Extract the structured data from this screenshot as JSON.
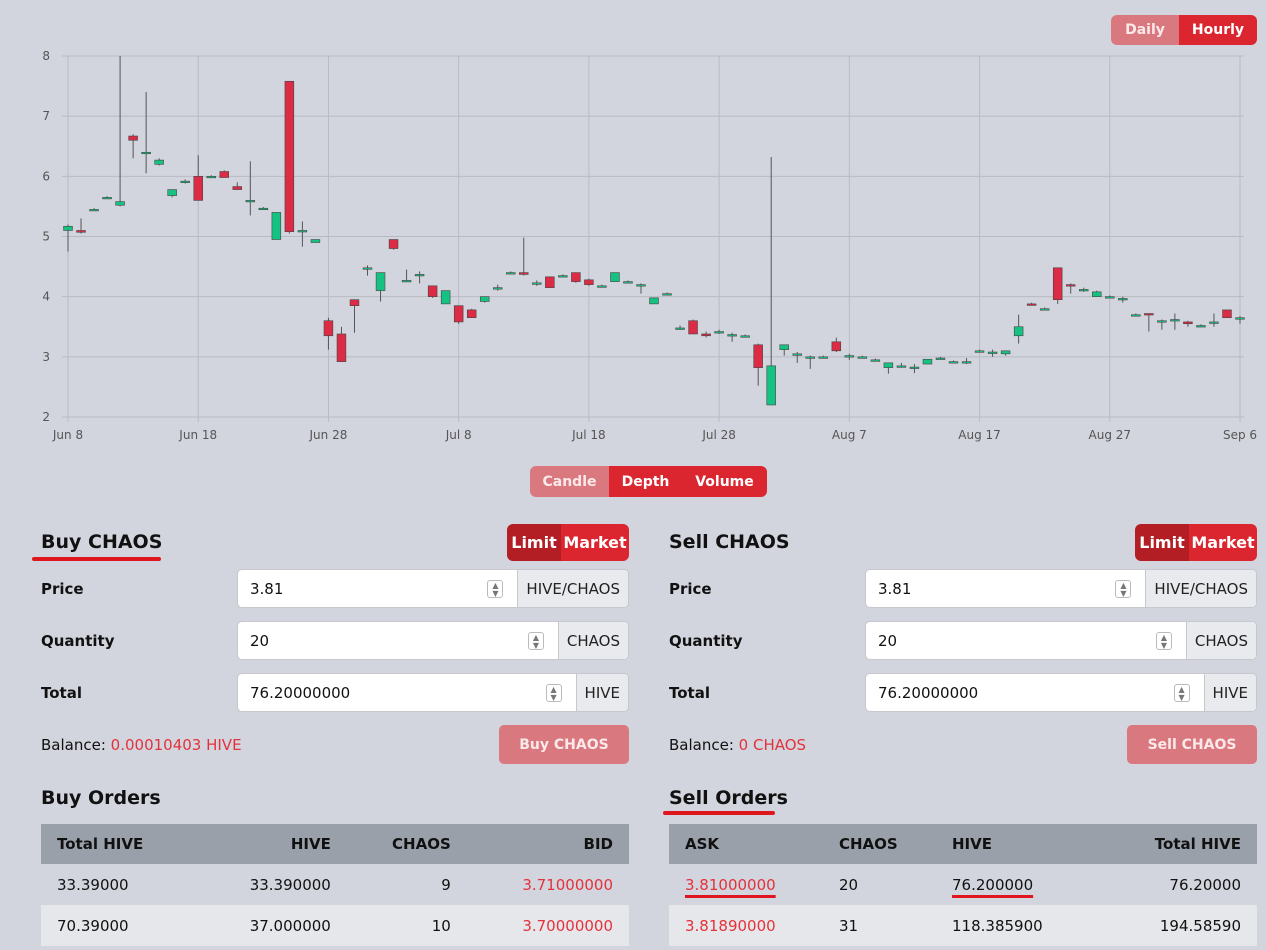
{
  "timeframe": {
    "daily": "Daily",
    "hourly": "Hourly"
  },
  "chart_view": {
    "candle": "Candle",
    "depth": "Depth",
    "volume": "Volume"
  },
  "colors": {
    "up": "#16c281",
    "down": "#dc2b45",
    "accent": "#dc262f"
  },
  "chart_data": {
    "type": "candlestick",
    "y_ticks": [
      "2",
      "3",
      "4",
      "5",
      "6",
      "7",
      "8"
    ],
    "ylim": [
      2,
      8
    ],
    "x_ticks": [
      "Jun 8",
      "Jun 18",
      "Jun 28",
      "Jul 8",
      "Jul 18",
      "Jul 28",
      "Aug 7",
      "Aug 17",
      "Aug 27",
      "Sep 6"
    ],
    "grid": true,
    "candles": [
      {
        "o": 5.1,
        "h": 5.2,
        "l": 4.75,
        "c": 5.17
      },
      {
        "o": 5.1,
        "h": 5.3,
        "l": 5.05,
        "c": 5.07
      },
      {
        "o": 5.45,
        "h": 5.47,
        "l": 5.43,
        "c": 5.45
      },
      {
        "o": 5.65,
        "h": 5.67,
        "l": 5.63,
        "c": 5.65
      },
      {
        "o": 5.52,
        "h": 8.0,
        "l": 5.5,
        "c": 5.58
      },
      {
        "o": 6.67,
        "h": 6.7,
        "l": 6.3,
        "c": 6.6
      },
      {
        "o": 6.4,
        "h": 7.4,
        "l": 6.05,
        "c": 6.4
      },
      {
        "o": 6.2,
        "h": 6.3,
        "l": 6.18,
        "c": 6.27
      },
      {
        "o": 5.68,
        "h": 5.78,
        "l": 5.65,
        "c": 5.78
      },
      {
        "o": 5.92,
        "h": 5.95,
        "l": 5.88,
        "c": 5.92
      },
      {
        "o": 6.0,
        "h": 6.35,
        "l": 5.6,
        "c": 5.6
      },
      {
        "o": 6.0,
        "h": 6.02,
        "l": 5.98,
        "c": 6.0
      },
      {
        "o": 6.08,
        "h": 6.1,
        "l": 5.98,
        "c": 5.98
      },
      {
        "o": 5.83,
        "h": 5.9,
        "l": 5.78,
        "c": 5.78
      },
      {
        "o": 5.6,
        "h": 6.25,
        "l": 5.35,
        "c": 5.6
      },
      {
        "o": 5.47,
        "h": 5.49,
        "l": 5.45,
        "c": 5.47
      },
      {
        "o": 4.95,
        "h": 5.4,
        "l": 4.95,
        "c": 5.4
      },
      {
        "o": 7.58,
        "h": 7.58,
        "l": 5.05,
        "c": 5.08
      },
      {
        "o": 5.1,
        "h": 5.25,
        "l": 4.83,
        "c": 5.1
      },
      {
        "o": 4.9,
        "h": 4.95,
        "l": 4.9,
        "c": 4.95
      },
      {
        "o": 3.6,
        "h": 3.65,
        "l": 3.12,
        "c": 3.35
      },
      {
        "o": 3.38,
        "h": 3.5,
        "l": 2.92,
        "c": 2.92
      },
      {
        "o": 3.95,
        "h": 3.95,
        "l": 3.4,
        "c": 3.85
      },
      {
        "o": 4.48,
        "h": 4.52,
        "l": 4.35,
        "c": 4.48
      },
      {
        "o": 4.1,
        "h": 4.4,
        "l": 3.92,
        "c": 4.4
      },
      {
        "o": 4.95,
        "h": 4.95,
        "l": 4.78,
        "c": 4.8
      },
      {
        "o": 4.27,
        "h": 4.45,
        "l": 4.27,
        "c": 4.27
      },
      {
        "o": 4.37,
        "h": 4.42,
        "l": 4.22,
        "c": 4.37
      },
      {
        "o": 4.18,
        "h": 4.18,
        "l": 3.98,
        "c": 4.0
      },
      {
        "o": 3.88,
        "h": 4.1,
        "l": 3.88,
        "c": 4.1
      },
      {
        "o": 3.85,
        "h": 3.85,
        "l": 3.55,
        "c": 3.58
      },
      {
        "o": 3.78,
        "h": 3.8,
        "l": 3.65,
        "c": 3.65
      },
      {
        "o": 3.92,
        "h": 4.0,
        "l": 3.9,
        "c": 4.0
      },
      {
        "o": 4.15,
        "h": 4.2,
        "l": 4.1,
        "c": 4.15
      },
      {
        "o": 4.4,
        "h": 4.42,
        "l": 4.38,
        "c": 4.4
      },
      {
        "o": 4.4,
        "h": 4.98,
        "l": 4.35,
        "c": 4.37
      },
      {
        "o": 4.23,
        "h": 4.27,
        "l": 4.18,
        "c": 4.23
      },
      {
        "o": 4.33,
        "h": 4.33,
        "l": 4.15,
        "c": 4.15
      },
      {
        "o": 4.35,
        "h": 4.37,
        "l": 4.33,
        "c": 4.35
      },
      {
        "o": 4.4,
        "h": 4.4,
        "l": 4.23,
        "c": 4.25
      },
      {
        "o": 4.28,
        "h": 4.3,
        "l": 4.18,
        "c": 4.2
      },
      {
        "o": 4.18,
        "h": 4.2,
        "l": 4.16,
        "c": 4.18
      },
      {
        "o": 4.25,
        "h": 4.4,
        "l": 4.25,
        "c": 4.4
      },
      {
        "o": 4.25,
        "h": 4.27,
        "l": 4.22,
        "c": 4.25
      },
      {
        "o": 4.2,
        "h": 4.22,
        "l": 4.05,
        "c": 4.2
      },
      {
        "o": 3.88,
        "h": 3.98,
        "l": 3.88,
        "c": 3.98
      },
      {
        "o": 4.05,
        "h": 4.07,
        "l": 4.03,
        "c": 4.05
      },
      {
        "o": 3.48,
        "h": 3.52,
        "l": 3.45,
        "c": 3.48
      },
      {
        "o": 3.6,
        "h": 3.62,
        "l": 3.38,
        "c": 3.38
      },
      {
        "o": 3.38,
        "h": 3.42,
        "l": 3.32,
        "c": 3.35
      },
      {
        "o": 3.42,
        "h": 3.45,
        "l": 3.38,
        "c": 3.42
      },
      {
        "o": 3.37,
        "h": 3.4,
        "l": 3.25,
        "c": 3.37
      },
      {
        "o": 3.35,
        "h": 3.37,
        "l": 3.33,
        "c": 3.35
      },
      {
        "o": 3.2,
        "h": 3.22,
        "l": 2.52,
        "c": 2.82
      },
      {
        "o": 2.2,
        "h": 6.32,
        "l": 2.2,
        "c": 2.85
      },
      {
        "o": 3.12,
        "h": 3.2,
        "l": 3.02,
        "c": 3.2
      },
      {
        "o": 3.05,
        "h": 3.08,
        "l": 2.9,
        "c": 3.05
      },
      {
        "o": 3.0,
        "h": 3.02,
        "l": 2.8,
        "c": 3.0
      },
      {
        "o": 3.0,
        "h": 3.02,
        "l": 2.98,
        "c": 3.0
      },
      {
        "o": 3.25,
        "h": 3.32,
        "l": 3.08,
        "c": 3.1
      },
      {
        "o": 3.02,
        "h": 3.05,
        "l": 2.95,
        "c": 3.02
      },
      {
        "o": 3.0,
        "h": 3.02,
        "l": 2.98,
        "c": 3.0
      },
      {
        "o": 2.95,
        "h": 2.97,
        "l": 2.93,
        "c": 2.95
      },
      {
        "o": 2.82,
        "h": 2.9,
        "l": 2.72,
        "c": 2.9
      },
      {
        "o": 2.85,
        "h": 2.9,
        "l": 2.82,
        "c": 2.85
      },
      {
        "o": 2.83,
        "h": 2.88,
        "l": 2.73,
        "c": 2.83
      },
      {
        "o": 2.88,
        "h": 2.96,
        "l": 2.88,
        "c": 2.96
      },
      {
        "o": 2.98,
        "h": 3.0,
        "l": 2.96,
        "c": 2.98
      },
      {
        "o": 2.92,
        "h": 2.94,
        "l": 2.9,
        "c": 2.92
      },
      {
        "o": 2.92,
        "h": 2.98,
        "l": 2.88,
        "c": 2.92
      },
      {
        "o": 3.1,
        "h": 3.12,
        "l": 3.08,
        "c": 3.1
      },
      {
        "o": 3.08,
        "h": 3.12,
        "l": 3.0,
        "c": 3.08
      },
      {
        "o": 3.05,
        "h": 3.1,
        "l": 3.02,
        "c": 3.1
      },
      {
        "o": 3.35,
        "h": 3.7,
        "l": 3.22,
        "c": 3.5
      },
      {
        "o": 3.88,
        "h": 3.9,
        "l": 3.85,
        "c": 3.86
      },
      {
        "o": 3.8,
        "h": 3.82,
        "l": 3.78,
        "c": 3.8
      },
      {
        "o": 4.48,
        "h": 4.48,
        "l": 3.88,
        "c": 3.95
      },
      {
        "o": 4.2,
        "h": 4.22,
        "l": 4.05,
        "c": 4.18
      },
      {
        "o": 4.12,
        "h": 4.15,
        "l": 4.08,
        "c": 4.12
      },
      {
        "o": 4.0,
        "h": 4.1,
        "l": 4.0,
        "c": 4.08
      },
      {
        "o": 4.0,
        "h": 4.02,
        "l": 3.98,
        "c": 4.0
      },
      {
        "o": 3.97,
        "h": 4.0,
        "l": 3.9,
        "c": 3.97
      },
      {
        "o": 3.7,
        "h": 3.72,
        "l": 3.68,
        "c": 3.7
      },
      {
        "o": 3.72,
        "h": 3.72,
        "l": 3.42,
        "c": 3.7
      },
      {
        "o": 3.6,
        "h": 3.62,
        "l": 3.45,
        "c": 3.6
      },
      {
        "o": 3.62,
        "h": 3.72,
        "l": 3.45,
        "c": 3.62
      },
      {
        "o": 3.58,
        "h": 3.6,
        "l": 3.5,
        "c": 3.55
      },
      {
        "o": 3.52,
        "h": 3.54,
        "l": 3.5,
        "c": 3.52
      },
      {
        "o": 3.58,
        "h": 3.72,
        "l": 3.5,
        "c": 3.58
      },
      {
        "o": 3.78,
        "h": 3.78,
        "l": 3.65,
        "c": 3.65
      },
      {
        "o": 3.65,
        "h": 3.68,
        "l": 3.55,
        "c": 3.65
      }
    ]
  },
  "buy": {
    "title": "Buy CHAOS",
    "mode": {
      "limit": "Limit",
      "market": "Market"
    },
    "price": {
      "label": "Price",
      "value": "3.81",
      "unit": "HIVE/CHAOS"
    },
    "quantity": {
      "label": "Quantity",
      "value": "20",
      "unit": "CHAOS"
    },
    "total": {
      "label": "Total",
      "value": "76.20000000",
      "unit": "HIVE"
    },
    "balance_label": "Balance:",
    "balance_value": "0.00010403 HIVE",
    "button": "Buy CHAOS"
  },
  "sell": {
    "title": "Sell CHAOS",
    "mode": {
      "limit": "Limit",
      "market": "Market"
    },
    "price": {
      "label": "Price",
      "value": "3.81",
      "unit": "HIVE/CHAOS"
    },
    "quantity": {
      "label": "Quantity",
      "value": "20",
      "unit": "CHAOS"
    },
    "total": {
      "label": "Total",
      "value": "76.20000000",
      "unit": "HIVE"
    },
    "balance_label": "Balance:",
    "balance_value": "0 CHAOS",
    "button": "Sell CHAOS"
  },
  "buy_orders": {
    "title": "Buy Orders",
    "headers": [
      "Total HIVE",
      "HIVE",
      "CHAOS",
      "BID"
    ],
    "rows": [
      [
        "33.39000",
        "33.390000",
        "9",
        "3.71000000"
      ],
      [
        "70.39000",
        "37.000000",
        "10",
        "3.70000000"
      ]
    ]
  },
  "sell_orders": {
    "title": "Sell Orders",
    "headers": [
      "ASK",
      "CHAOS",
      "HIVE",
      "Total HIVE"
    ],
    "rows": [
      [
        "3.81000000",
        "20",
        "76.200000",
        "76.20000"
      ],
      [
        "3.81890000",
        "31",
        "118.385900",
        "194.58590"
      ]
    ]
  }
}
